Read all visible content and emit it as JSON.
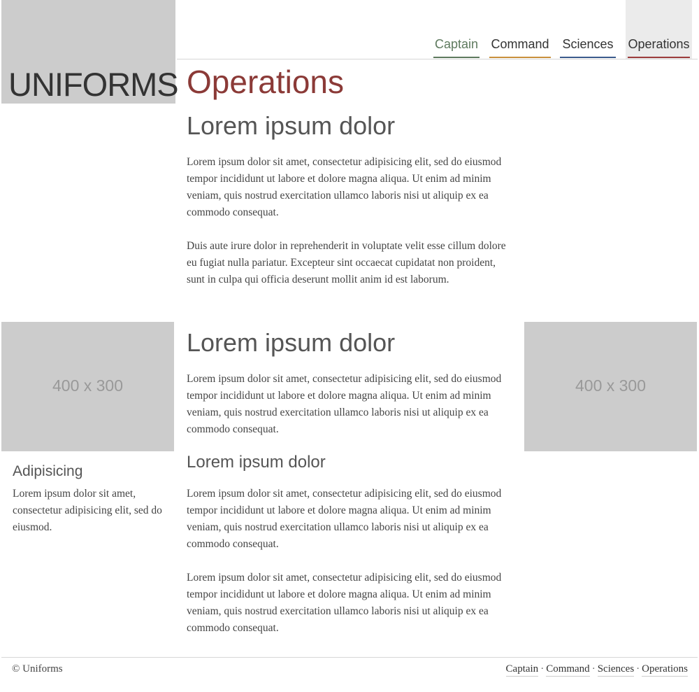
{
  "logo": {
    "text": "UNIFORMS"
  },
  "nav": {
    "items": [
      {
        "label": "Captain",
        "color": "#5e7a5e"
      },
      {
        "label": "Command",
        "color": "#c8903c"
      },
      {
        "label": "Sciences",
        "color": "#3a5b8c"
      },
      {
        "label": "Operations",
        "color": "#9b3b3b",
        "active": true
      }
    ]
  },
  "page": {
    "title": "Operations",
    "title_color": "#8b3a37"
  },
  "section1": {
    "heading": "Lorem ipsum dolor",
    "paragraphs": [
      "Lorem ipsum dolor sit amet, consectetur adipisicing elit, sed do eiusmod tempor incididunt ut labore et dolore magna aliqua. Ut enim ad minim veniam, quis nostrud exercitation ullamco laboris nisi ut aliquip ex ea commodo consequat.",
      "Duis aute irure dolor in reprehenderit in voluptate velit esse cillum dolore eu fugiat nulla pariatur. Excepteur sint occaecat cupidatat non proident, sunt in culpa qui officia deserunt mollit anim id est laborum."
    ]
  },
  "section2": {
    "heading": "Lorem ipsum dolor",
    "paragraph": "Lorem ipsum dolor sit amet, consectetur adipisicing elit, sed do eiusmod tempor incididunt ut labore et dolore magna aliqua. Ut enim ad minim veniam, quis nostrud exercitation ullamco laboris nisi ut aliquip ex ea commodo consequat.",
    "subheading": "Lorem ipsum dolor",
    "paragraphs": [
      "Lorem ipsum dolor sit amet, consectetur adipisicing elit, sed do eiusmod tempor incididunt ut labore et dolore magna aliqua. Ut enim ad minim veniam, quis nostrud exercitation ullamco laboris nisi ut aliquip ex ea commodo consequat.",
      "Lorem ipsum dolor sit amet, consectetur adipisicing elit, sed do eiusmod tempor incididunt ut labore et dolore magna aliqua. Ut enim ad minim veniam, quis nostrud exercitation ullamco laboris nisi ut aliquip ex ea commodo consequat."
    ]
  },
  "placeholders": {
    "left": "400 x 300",
    "right": "400 x 300"
  },
  "sidebar_card": {
    "heading": "Adipisicing",
    "text": "Lorem ipsum dolor sit amet, consectetur adipisicing elit, sed do eiusmod."
  },
  "footer": {
    "copyright": "© Uniforms",
    "links": [
      "Captain",
      "Command",
      "Sciences",
      "Operations"
    ],
    "separator": "·"
  }
}
